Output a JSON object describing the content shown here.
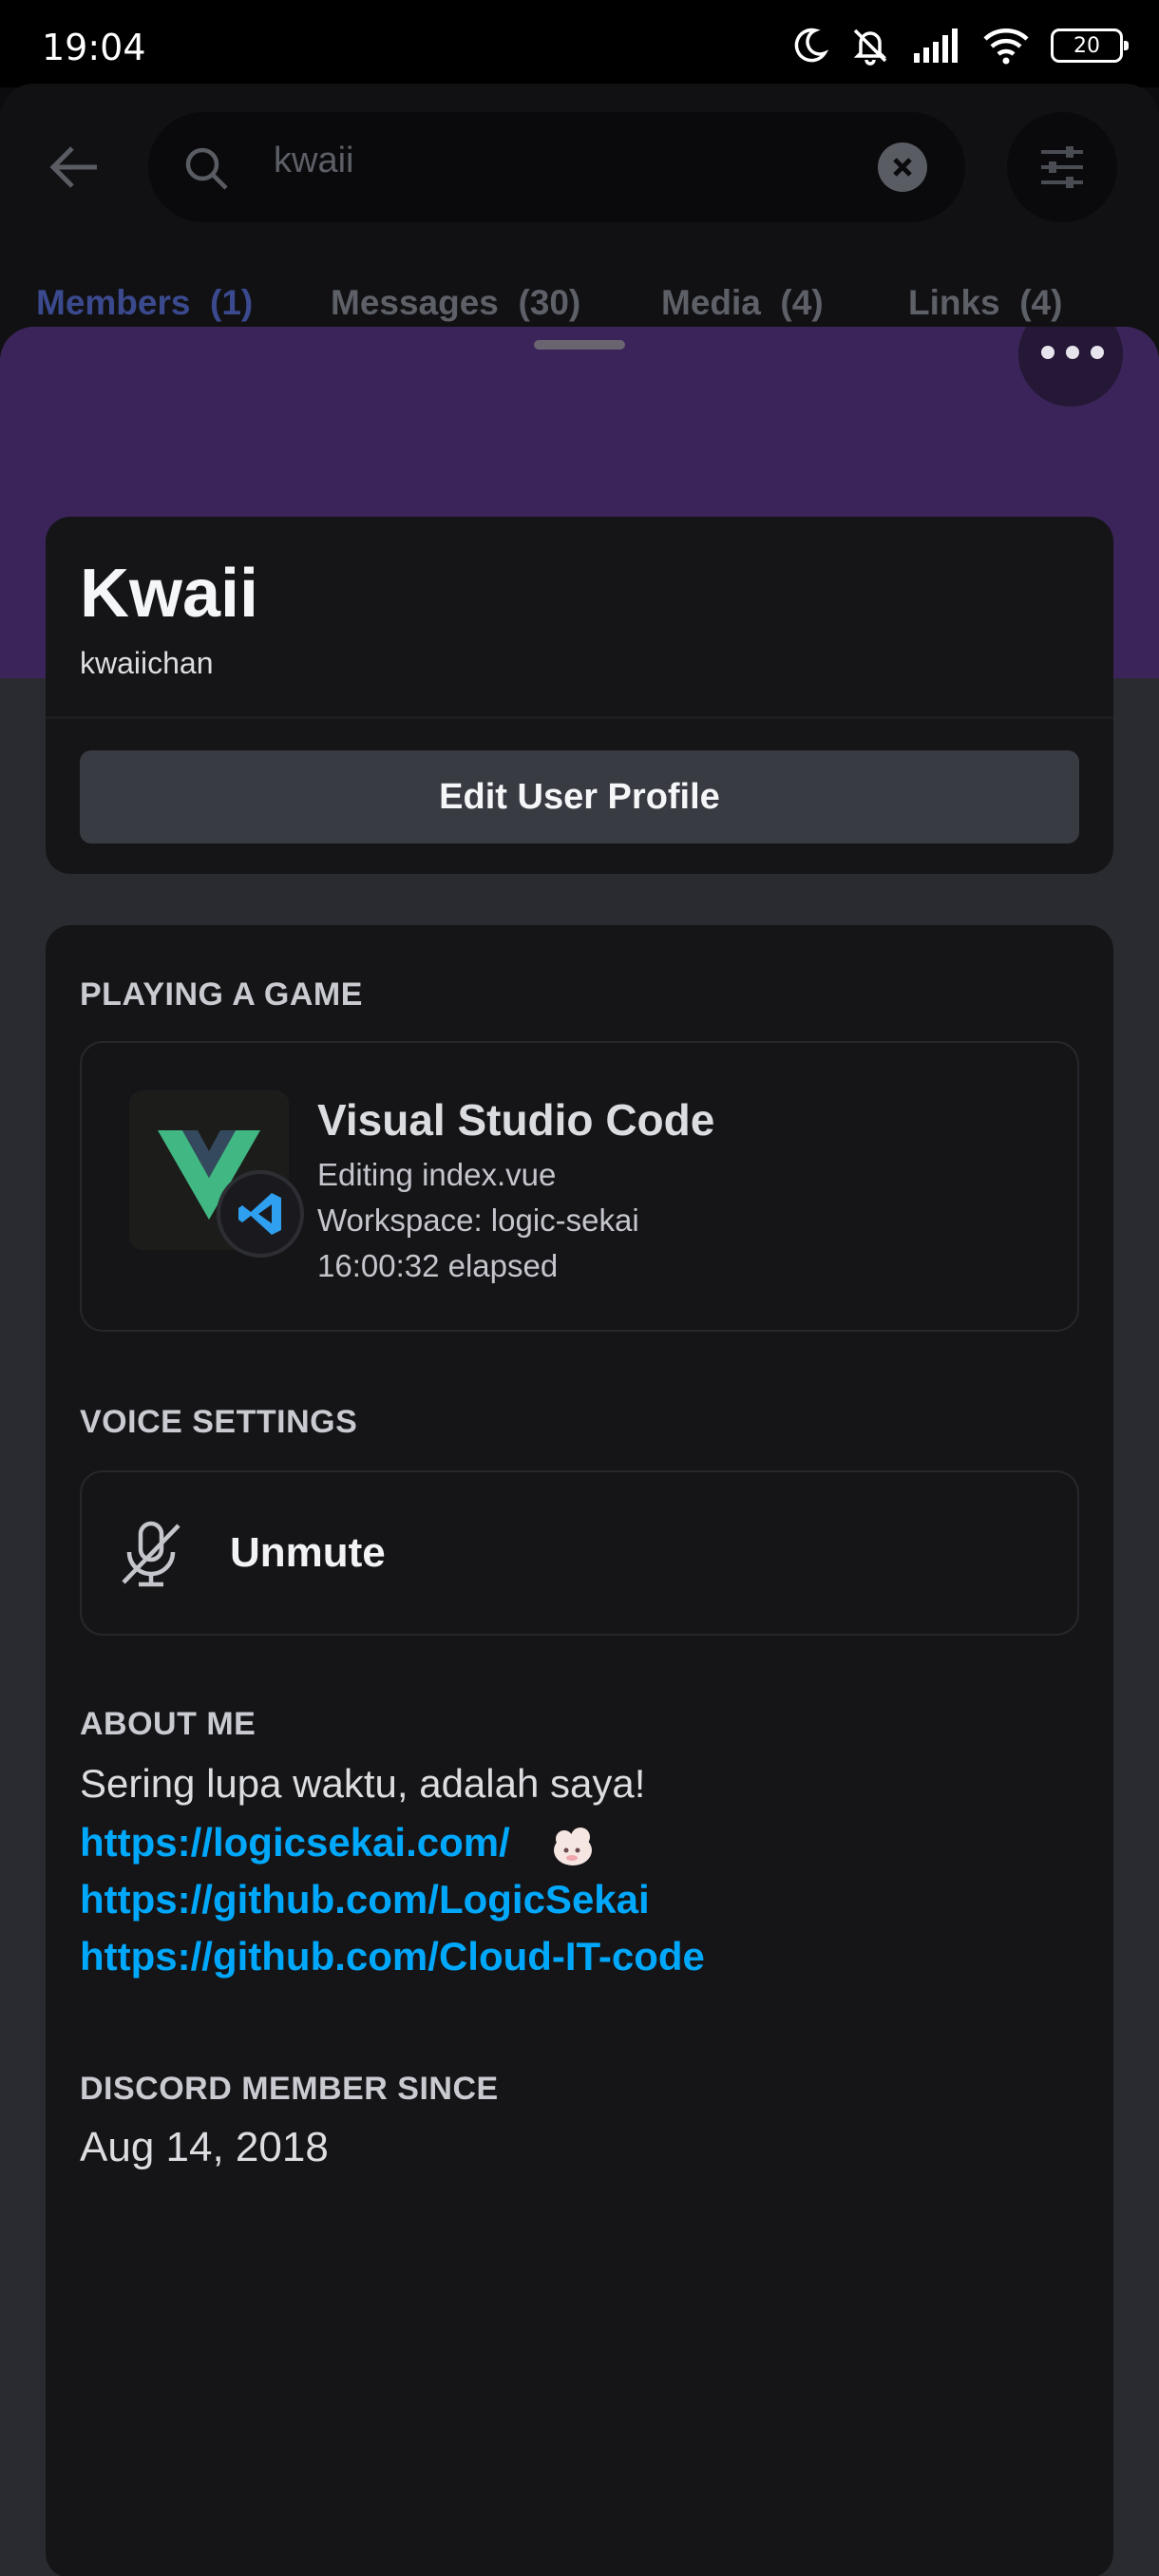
{
  "status_bar": {
    "time": "19:04",
    "battery": "20"
  },
  "search": {
    "query": "kwaii",
    "tabs": [
      {
        "label": "Members",
        "count": "(1)"
      },
      {
        "label": "Messages",
        "count": "(30)"
      },
      {
        "label": "Media",
        "count": "(4)"
      },
      {
        "label": "Links",
        "count": "(4)"
      }
    ]
  },
  "profile": {
    "display_name": "Kwaii",
    "username": "kwaiichan",
    "edit_button": "Edit User Profile",
    "status": "idle-moon-icon",
    "badges": [
      "hypesquad-badge-icon",
      "active-developer-badge-icon",
      "early-supporter-badge-icon"
    ]
  },
  "activity": {
    "section_label": "PLAYING A GAME",
    "app": "Visual Studio Code",
    "details": "Editing index.vue",
    "state": "Workspace: logic-sekai",
    "elapsed": "16:00:32 elapsed"
  },
  "voice": {
    "section_label": "VOICE SETTINGS",
    "action": "Unmute"
  },
  "about": {
    "section_label": "ABOUT ME",
    "text": "Sering lupa waktu, adalah saya!",
    "links": [
      "https://logicsekai.com/",
      "https://github.com/LogicSekai",
      "https://github.com/Cloud-IT-code"
    ]
  },
  "member_since": {
    "section_label": "DISCORD MEMBER SINCE",
    "date": "Aug 14, 2018"
  },
  "colors": {
    "banner": "#3b2459",
    "link": "#00a8fc",
    "idle": "#f0b232",
    "card": "#151518",
    "sheet": "#2a2b30"
  }
}
